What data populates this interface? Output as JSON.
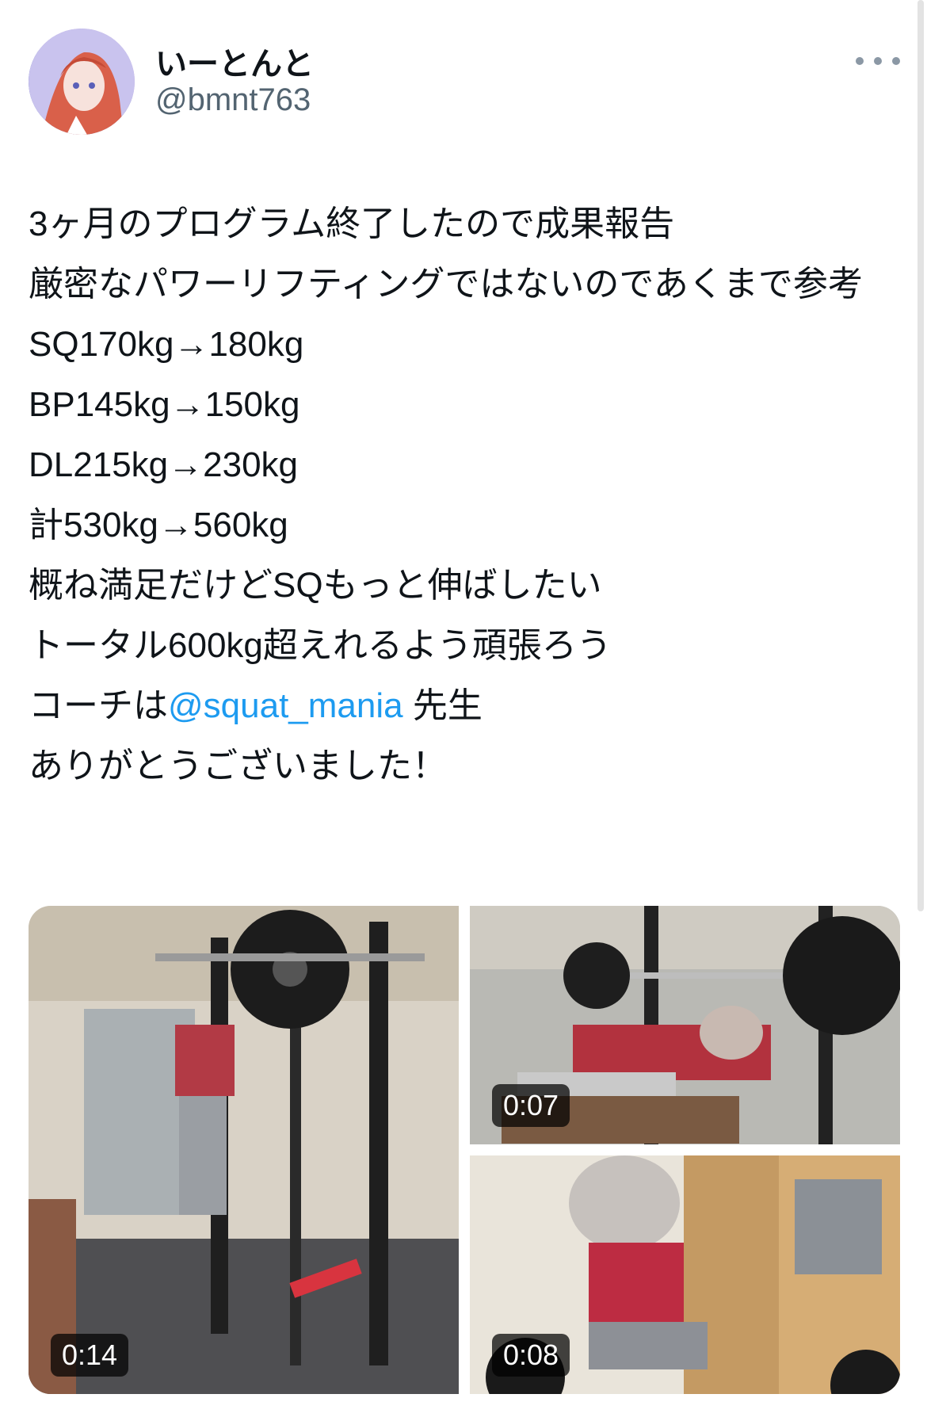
{
  "author": {
    "display_name": "いーとんと",
    "handle": "@bmnt763",
    "avatar_icon": "avatar-icon"
  },
  "tweet": {
    "lines": [
      {
        "text": "3ヶ月のプログラム終了したので成果報告"
      },
      {
        "text": "厳密なパワーリフティングではないのであくまで参考"
      },
      {
        "text": "SQ170kg→180kg"
      },
      {
        "text": "BP145kg→150kg"
      },
      {
        "text": "DL215kg→230kg"
      },
      {
        "text": "計530kg→560kg"
      },
      {
        "text": "概ね満足だけどSQもっと伸ばしたい"
      },
      {
        "text": "トータル600kg超えれるよう頑張ろう"
      },
      {
        "text_before": "コーチは",
        "mention": "@squat_mania",
        "text_after": " 先生"
      },
      {
        "text": "ありがとうございました！"
      }
    ],
    "mention_color": "#1d9bf0"
  },
  "media": {
    "videos": [
      {
        "duration": "0:14",
        "icon": "squat-video-thumbnail"
      },
      {
        "duration": "0:07",
        "icon": "bench-press-video-thumbnail"
      },
      {
        "duration": "0:08",
        "icon": "deadlift-video-thumbnail"
      }
    ]
  }
}
